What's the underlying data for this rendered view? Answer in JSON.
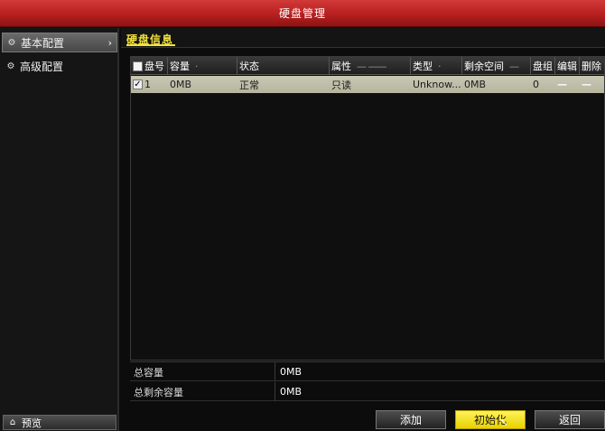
{
  "window": {
    "title": "硬盘管理"
  },
  "sidebar": {
    "items": [
      {
        "label": "基本配置",
        "icon": "gear-icon",
        "active": true
      },
      {
        "label": "高级配置",
        "icon": "gears-icon",
        "active": false
      }
    ],
    "preview_label": "预览"
  },
  "tab": {
    "label": "硬盘信息"
  },
  "table": {
    "headers": [
      "盘号",
      "容量",
      "状态",
      "属性",
      "类型",
      "剩余空间",
      "盘组",
      "编辑",
      "删除"
    ],
    "rows": [
      {
        "checked": true,
        "no": "1",
        "capacity": "0MB",
        "status": "正常",
        "attr": "只读",
        "type": "Unknow...",
        "free": "0MB",
        "group": "0",
        "edit": "—",
        "delete": "—"
      }
    ]
  },
  "summary": {
    "total_label": "总容量",
    "total_value": "0MB",
    "free_label": "总剩余容量",
    "free_value": "0MB"
  },
  "buttons": {
    "add": "添加",
    "init": "初始化",
    "back": "返回"
  },
  "colors": {
    "title_red": "#b71f1f",
    "accent_yellow": "#f2e23c",
    "row_selected": "#c3c2ad"
  }
}
